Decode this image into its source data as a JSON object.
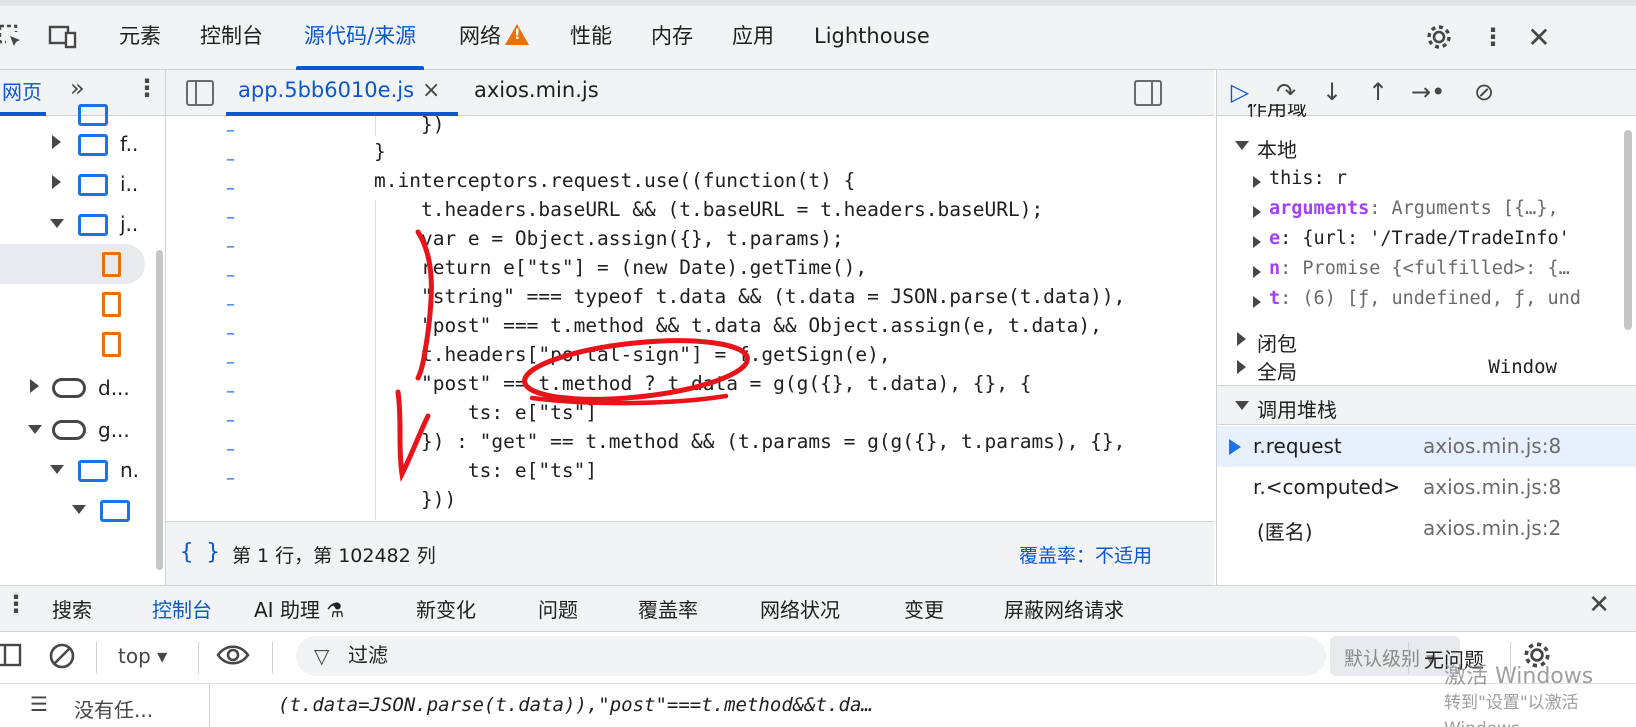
{
  "top_tabs": [
    "元素",
    "控制台",
    "源代码/来源",
    "网络",
    "性能",
    "内存",
    "应用",
    "Lighthouse"
  ],
  "active_top_tab": "源代码/来源",
  "navigator": {
    "tab_label": "网页",
    "tree": [
      {
        "name": "f..",
        "kind": "folder"
      },
      {
        "name": "i..",
        "kind": "folder"
      },
      {
        "name": "j..",
        "kind": "folder"
      },
      {
        "name": "d...",
        "kind": "cloud"
      },
      {
        "name": "g...",
        "kind": "cloud"
      },
      {
        "name": "n.",
        "kind": "folder"
      }
    ]
  },
  "editor": {
    "tabs": [
      {
        "label": "app.5bb6010e.js",
        "active": true,
        "close": "×"
      },
      {
        "label": "axios.min.js",
        "active": false
      }
    ],
    "gutter_mark": "–",
    "code_lines": [
      "    })",
      "}",
      "m.interceptors.request.use((function(t) {",
      "    t.headers.baseURL && (t.baseURL = t.headers.baseURL);",
      "    var e = Object.assign({}, t.params);",
      "    return e[\"ts\"] = (new Date).getTime(),",
      "    \"string\" === typeof t.data && (t.data = JSON.parse(t.data)),",
      "    \"post\" === t.method && t.data && Object.assign(e, t.data),",
      "    t.headers[\"portal-sign\"] = f.getSign(e),",
      "    \"post\" == t.method ? t.data = g(g({}, t.data), {}, {",
      "        ts: e[\"ts\"]",
      "    }) : \"get\" == t.method && (t.params = g(g({}, t.params), {},",
      "        ts: e[\"ts\"]",
      "    }))"
    ],
    "status": {
      "braces": "{ }",
      "position": "第 1 行，第 102482 列",
      "coverage": "覆盖率：不适用"
    }
  },
  "debugger": {
    "scope_title_partial": "作用域",
    "local_title": "本地",
    "scope_vars": [
      {
        "key": "this",
        "value": ": r",
        "bold": false
      },
      {
        "key": "arguments",
        "value": ": Arguments [{…}, ",
        "bold": true
      },
      {
        "key": "e",
        "value": ": {url: '/Trade/TradeInfo'",
        "bold": true
      },
      {
        "key": "n",
        "value": ": Promise {<fulfilled>: {…",
        "bold": true
      },
      {
        "key": "t",
        "value": ": (6) [ƒ, undefined, ƒ, und",
        "bold": true
      }
    ],
    "closure_title": "闭包",
    "global_title": "全局",
    "global_value": "Window",
    "callstack_title": "调用堆栈",
    "frames": [
      {
        "name": "r.request",
        "location": "axios.min.js:8",
        "current": true
      },
      {
        "name": "r.<computed>",
        "location": "axios.min.js:8",
        "current": false
      },
      {
        "name": "(匿名)",
        "location": "axios.min.js:2",
        "current": false
      }
    ]
  },
  "drawer": {
    "tabs": [
      "搜索",
      "控制台",
      "AI 助理 ⚗",
      "新变化",
      "问题",
      "覆盖率",
      "网络状况",
      "变更",
      "屏蔽网络请求"
    ],
    "active_tab": "控制台",
    "context": "top",
    "filter_placeholder": "过滤",
    "levels": "默认级别 ▾",
    "no_issues": "无问题",
    "sidebar_text": "没有任...",
    "console_line": "(t.data=JSON.parse(t.data)),\"post\"===t.method&&t.da…"
  },
  "watermark": {
    "line1": "激活 Windows",
    "line2": "转到\"设置\"以激活 Windows"
  },
  "colors": {
    "accent": "#0b57d0",
    "annotation": "#e8141a",
    "warning": "#e8710a"
  }
}
